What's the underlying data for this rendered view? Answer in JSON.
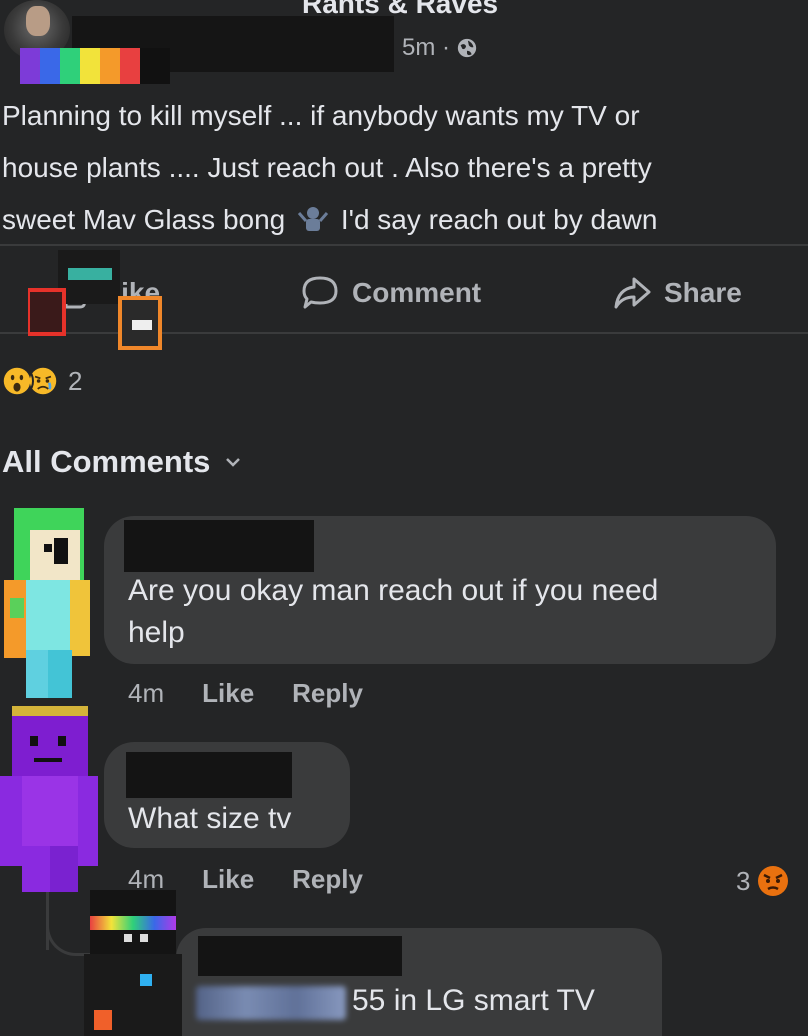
{
  "post": {
    "group_name": "Rants & Raves",
    "time": "5m ·",
    "text_line1": "Planning to kill myself ... if anybody wants my TV or",
    "text_line2": "house plants .... Just reach out . Also there's a pretty",
    "text_line3a": "sweet Mav Glass bong",
    "text_line3b": "I'd say reach out by dawn"
  },
  "actions": {
    "like": "Like",
    "comment": "Comment",
    "share": "Share"
  },
  "reactions": {
    "count": "2"
  },
  "comments_header": {
    "label": "All Comments"
  },
  "comments": [
    {
      "text_line1": "Are you okay man reach out if you need",
      "text_line2": "help",
      "time": "4m",
      "like": "Like",
      "reply": "Reply"
    },
    {
      "text": "What size tv",
      "time": "4m",
      "like": "Like",
      "reply": "Reply",
      "reaction_count": "3"
    },
    {
      "text": "55 in LG smart TV"
    }
  ],
  "colors": {
    "background": "#242526",
    "bubble": "#3a3b3c",
    "text": "#e4e6eb",
    "muted": "#b0b3b8"
  }
}
